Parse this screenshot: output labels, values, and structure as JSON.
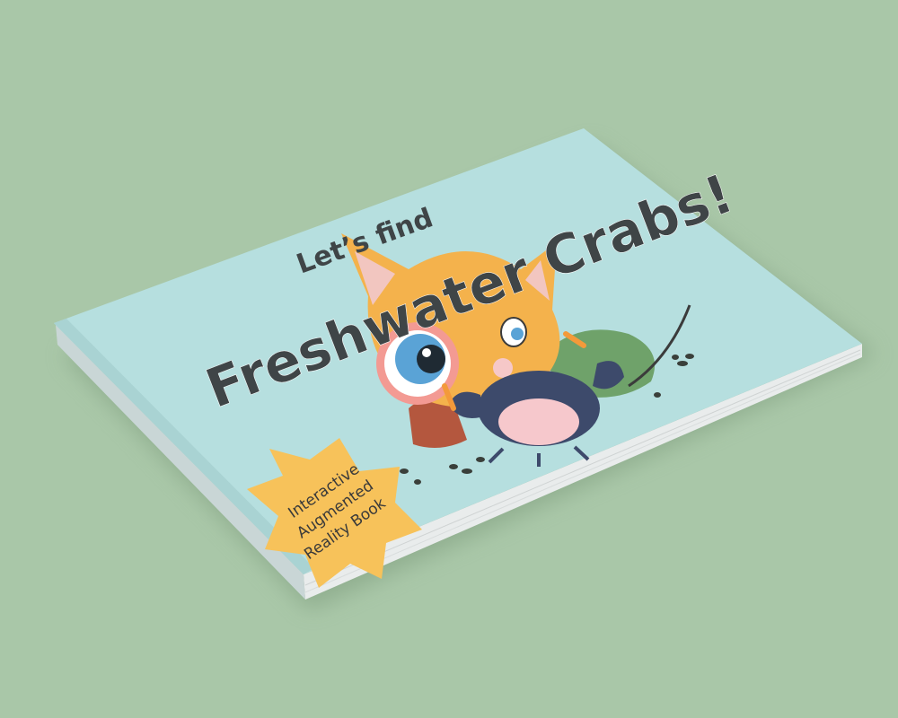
{
  "cover": {
    "subtitle": "Let’s find",
    "title": "Freshwater Crabs!",
    "badge_line_1": "Interactive",
    "badge_line_2": "Augmented",
    "badge_line_3": "Reality Book"
  },
  "colors": {
    "background": "#a9c7a8",
    "cover": "#b6dfdf",
    "pages": "#eeeeee",
    "title_text": "#3f4547",
    "badge": "#f7c25a",
    "fox": "#f4b24c",
    "crab": "#3d4a6b"
  },
  "icons": {
    "character": "fox-with-magnifying-glass",
    "crab": "crab-illustration",
    "badge": "starburst-badge"
  }
}
